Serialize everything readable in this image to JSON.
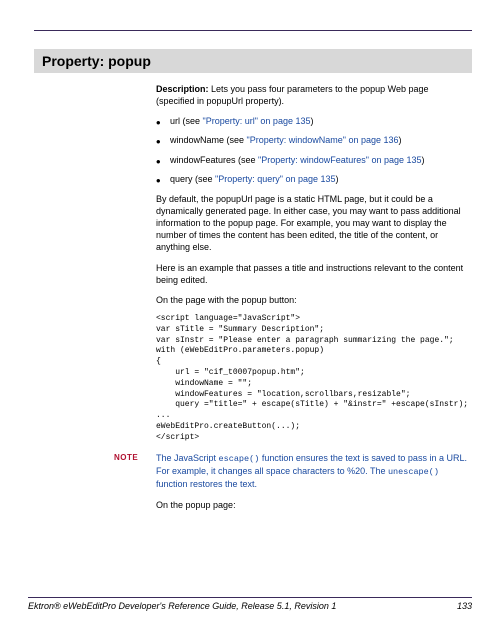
{
  "title": "Property: popup",
  "description_label": "Description:",
  "description_text": " Lets you pass four parameters to the popup Web page (specified in popupUrl property).",
  "bullets": [
    {
      "name": "url (see  ",
      "xref": "\"Property: url\" on page 135",
      "tail": ")"
    },
    {
      "name": "windowName (see  ",
      "xref": "\"Property: windowName\" on page 136",
      "tail": ")"
    },
    {
      "name": "windowFeatures (see  ",
      "xref": "\"Property: windowFeatures\" on page 135",
      "tail": ")"
    },
    {
      "name": "query (see  ",
      "xref": "\"Property: query\" on page 135",
      "tail": ")"
    }
  ],
  "para1": "By default, the popupUrl page is a static HTML page, but it could be a dynamically generated page. In either case, you may want to pass additional information to the popup page. For example, you may want to display the number of times the content has been edited, the title of the content, or anything else.",
  "para2": "Here is an example that passes a title and instructions relevant to the content being edited.",
  "para3": "On the page with the popup button:",
  "code1": "<script language=\"JavaScript\">\nvar sTitle = \"Summary Description\";\nvar sInstr = \"Please enter a paragraph summarizing the page.\";\nwith (eWebEditPro.parameters.popup)\n{\n    url = \"cif_t0007popup.htm\";\n    windowName = \"\";\n    windowFeatures = \"location,scrollbars,resizable\";\n    query =\"title=\" + escape(sTitle) + \"&instr=\" +escape(sInstr);\n...\neWebEditPro.createButton(...);\n</scr_ipt>",
  "note_label": "NOTE",
  "note_p1a": "The JavaScript ",
  "note_code1": "escape()",
  "note_p1b": " function ensures the text is saved to pass in a URL. For example, it changes all space characters to %20. The ",
  "note_code2": "unescape()",
  "note_p1c": " function restores the text.",
  "para4": "On the popup page:",
  "footer_text": "Ektron® eWebEditPro Developer's Reference Guide, Release 5.1, Revision 1",
  "page_number": "133"
}
